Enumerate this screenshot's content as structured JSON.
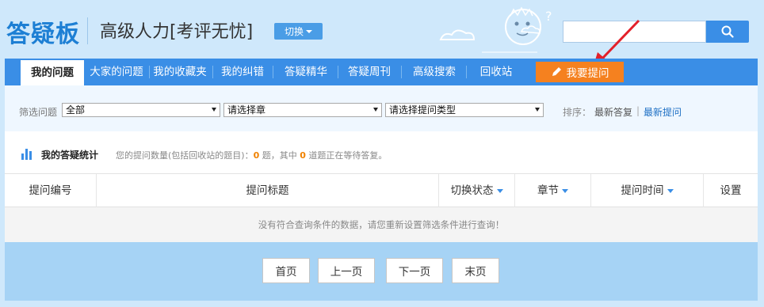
{
  "header": {
    "logo": "答疑板",
    "course": "高级人力[考评无忧]",
    "switch_label": "切换",
    "search_placeholder": ""
  },
  "nav": {
    "tabs": [
      "我的问题",
      "大家的问题",
      "我的收藏夹",
      "我的纠错",
      "答疑精华",
      "答疑周刊",
      "高级搜索",
      "回收站"
    ],
    "active": "我的问题",
    "ask_label": "我要提问"
  },
  "filter": {
    "label": "筛选问题",
    "select_all": "全部",
    "select_chapter": "请选择章",
    "select_type": "请选择提问类型",
    "sort_label": "排序：",
    "sort_latest_reply": "最新答复",
    "sort_sep": "|",
    "sort_latest_question": "最新提问"
  },
  "stats": {
    "title": "我的答疑统计",
    "text_1": "您的提问数量(包括回收站的题目)：",
    "count_total": "0",
    "text_2": " 题，其中 ",
    "count_waiting": "0",
    "text_3": " 道题正在等待答复。"
  },
  "table": {
    "headers": [
      "提问编号",
      "提问标题",
      "切换状态",
      "章节",
      "提问时间",
      "设置"
    ],
    "empty_message": "没有符合查询条件的数据，请您重新设置筛选条件进行查询！"
  },
  "pager": {
    "first": "首页",
    "prev": "上一页",
    "next": "下一页",
    "last": "末页"
  },
  "colors": {
    "nav_blue": "#3a8ee6",
    "ask_orange": "#f5811f",
    "logo_blue": "#1d7fd4",
    "count_orange": "#f08200"
  }
}
